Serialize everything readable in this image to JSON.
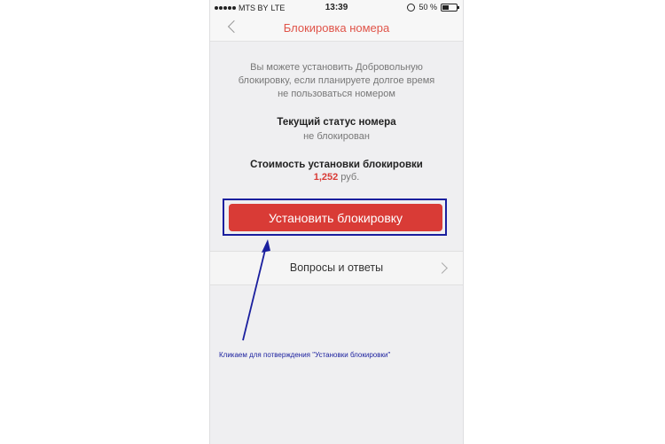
{
  "status_bar": {
    "carrier": "MTS BY",
    "network": "LTE",
    "time": "13:39",
    "battery": "50 %"
  },
  "nav": {
    "title": "Блокировка номера"
  },
  "main": {
    "info_line1": "Вы можете установить Добровольную",
    "info_line2": "блокировку, если планируете долгое время",
    "info_line3": "не пользоваться номером",
    "status_label": "Текущий статус номера",
    "status_value": "не блокирован",
    "cost_label": "Стоимость установки блокировки",
    "cost_value": "1,252",
    "cost_currency": "руб.",
    "install_button": "Установить блокировку",
    "faq_label": "Вопросы и ответы"
  },
  "annotation": {
    "text": "Кликаем для потверждения \"Установки блокировки\""
  },
  "colors": {
    "accent": "#d93b36",
    "title": "#e05449",
    "annotation": "#1a1f9e"
  }
}
